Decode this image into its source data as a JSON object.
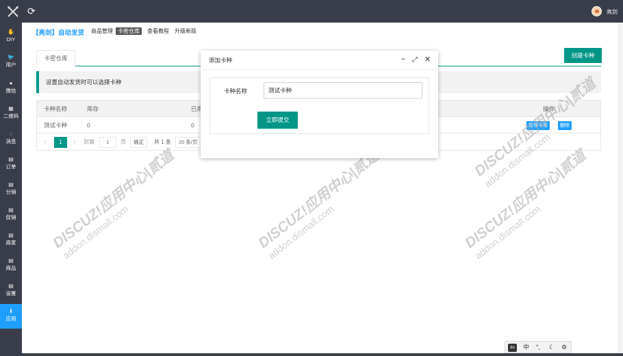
{
  "topbar": {
    "refresh_icon": "refresh-icon",
    "username": "亮剑"
  },
  "sidebar": {
    "items": [
      {
        "label": "DIY",
        "icon": "hand-icon"
      },
      {
        "label": "用户",
        "icon": "twitter-icon"
      },
      {
        "label": "微信",
        "icon": "wechat-icon"
      },
      {
        "label": "二维码",
        "icon": "qrcode-icon"
      },
      {
        "label": "消息",
        "icon": "comment-icon"
      },
      {
        "label": "订单",
        "icon": "document-icon"
      },
      {
        "label": "分销",
        "icon": "document-icon"
      },
      {
        "label": "促销",
        "icon": "document-icon"
      },
      {
        "label": "商家",
        "icon": "document-icon"
      },
      {
        "label": "商品",
        "icon": "document-icon"
      },
      {
        "label": "设置",
        "icon": "document-icon"
      },
      {
        "label": "应用",
        "icon": "download-icon",
        "active": true
      }
    ]
  },
  "header": {
    "brand": "【亮剑】自动发货",
    "nav": [
      "商品管理",
      "卡密仓库",
      "查看教程",
      "升级新版"
    ],
    "active_nav": "卡密仓库"
  },
  "main": {
    "tab_label": "卡密仓库",
    "create_button": "创建卡种",
    "tip": "设置自动发货时可以选择卡种",
    "table": {
      "columns": [
        "卡种名称",
        "库存",
        "已用",
        "操作"
      ],
      "rows": [
        {
          "name": "测试卡种",
          "stock": "0",
          "used": "0",
          "actions": [
            "管理卡密",
            "删除"
          ]
        }
      ]
    },
    "pager": {
      "current_page": "1",
      "goto_label": "到第",
      "page_input": "1",
      "page_unit": "页",
      "confirm": "确定",
      "total": "共 1 条",
      "page_size": "20 条/页"
    }
  },
  "watermark": {
    "text": "DISCUZ!应用中心|贰道",
    "sub": "addon.dismall.com"
  },
  "dialog": {
    "title": "添加卡种",
    "field_label": "卡种名称",
    "field_value": "测试卡种",
    "submit": "立即提交"
  },
  "ime": {
    "du": "du",
    "lang": "中",
    "punct": "°,",
    "moon": "☾",
    "gear": "⚙"
  },
  "colors": {
    "accent": "#009688",
    "blue": "#1e9fff",
    "dark": "#393d49"
  }
}
